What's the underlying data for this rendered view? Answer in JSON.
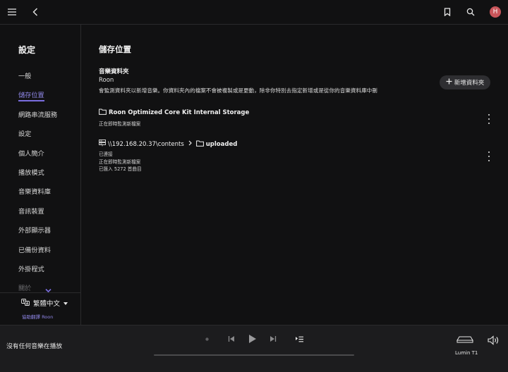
{
  "topbar": {
    "menu_icon": "hamburger-menu-icon",
    "back_icon": "back-arrow-icon",
    "bookmark_icon": "bookmark-icon",
    "search_icon": "search-icon",
    "avatar_letter": "H",
    "avatar_color": "#c9555a"
  },
  "sidebar": {
    "title": "設定",
    "items": [
      {
        "label": "一般"
      },
      {
        "label": "儲存位置"
      },
      {
        "label": "網路串流服務"
      },
      {
        "label": "設定"
      },
      {
        "label": "個人簡介"
      },
      {
        "label": "播放模式"
      },
      {
        "label": "音樂資料庫"
      },
      {
        "label": "音訊裝置"
      },
      {
        "label": "外部顯示器"
      },
      {
        "label": "已備份資料"
      },
      {
        "label": "外掛程式"
      },
      {
        "label": "關於"
      }
    ],
    "active_index": 1,
    "language": "繁體中文",
    "translate_link": "協助翻譯 Roon"
  },
  "main": {
    "title": "儲存位置",
    "section": {
      "title": "音樂資料夾",
      "subtitle": "Roon",
      "description": "會監測資料夾以新增音樂。你資料夾內的檔案不會被複製或是更動，除非你特別去指定新增或是從你的音樂資料庫中刪"
    },
    "add_button": "新增資料夾",
    "locations": [
      {
        "name": "Roon Optimized Core Kit Internal Storage",
        "status": [
          "正在即時監測新檔案"
        ]
      },
      {
        "path_prefix": "\\\\192.168.20.37\\contents",
        "folder": "uploaded",
        "status": [
          "已連接",
          "正在即時監測新檔案",
          "已匯入 5272 首曲目"
        ]
      }
    ]
  },
  "player": {
    "now_playing": "沒有任何音樂在播放",
    "progress": 0,
    "zone": "Lumin T1",
    "accent": "#7a6ee0"
  }
}
